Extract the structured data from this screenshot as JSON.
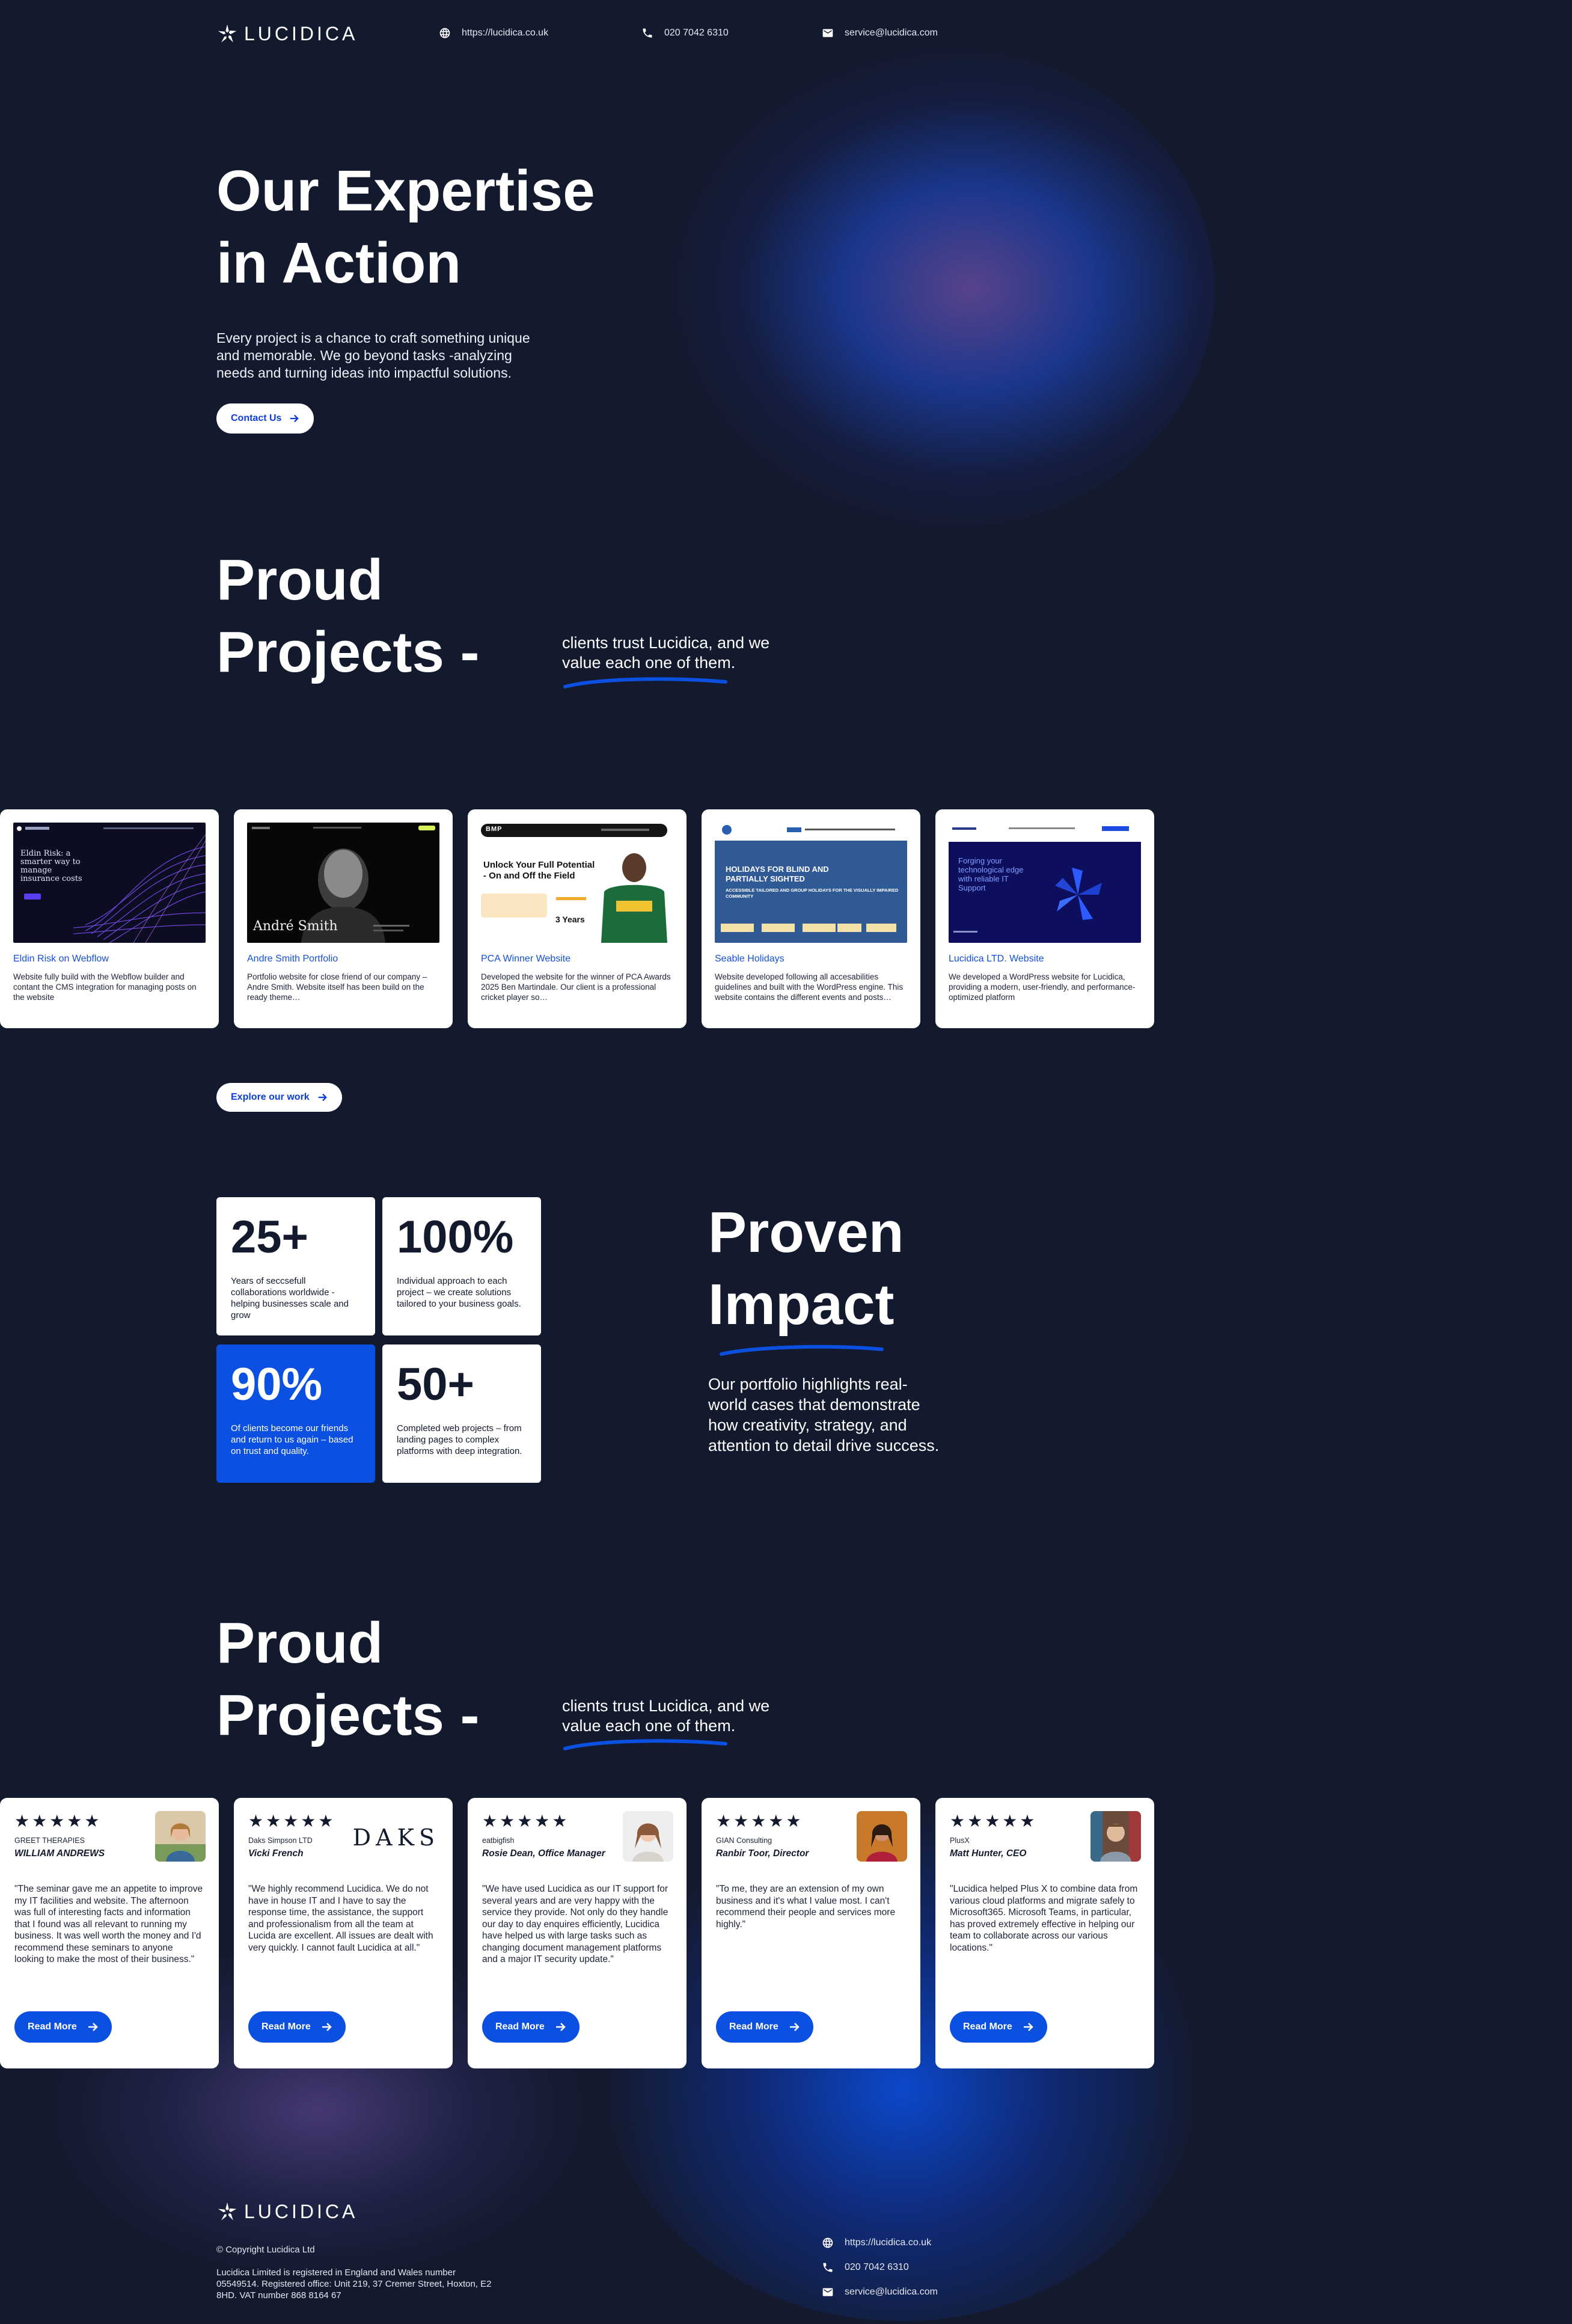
{
  "brand": {
    "name": "LUCIDICA"
  },
  "header": {
    "website": "https://lucidica.co.uk",
    "phone": "020 7042 6310",
    "email": "service@lucidica.com"
  },
  "hero": {
    "title_line1": "Our Expertise",
    "title_line2": "in Action",
    "text": "Every project is a chance to craft something unique and memorable. We go beyond tasks -analyzing needs and turning ideas into impactful solutions.",
    "cta": "Contact Us"
  },
  "projects_section": {
    "title_line1": "Proud",
    "title_line2": "Projects -",
    "trust_text": "clients trust Lucidica, and we value each one of them.",
    "explore": "Explore our work",
    "items": [
      {
        "title": "Eldin Risk on Webflow",
        "desc": "Website fully build with the Webflow builder and contant the CMS integration for managing posts on the website",
        "thumb": {
          "headline": "Eldin Risk: a smarter way to manage insurance costs"
        }
      },
      {
        "title": "Andre Smith Portfolio",
        "desc": "Portfolio website for close friend of our company – Andre Smith. Website itself has been build on the ready theme…",
        "thumb": {
          "headline": "André Smith"
        }
      },
      {
        "title": "PCA Winner Website",
        "desc": "Developed the website for the winner of PCA Awards 2025 Ben Martindale. Our client is a professional cricket player so…",
        "thumb": {
          "headline": "Unlock Your Full Potential - On and Off the Field",
          "badge": "3 Years",
          "logo": "BMP"
        }
      },
      {
        "title": "Seable Holidays",
        "desc": "Website developed following all accesabilities guidelines and built with the WordPress engine. This website contains the different events and posts…",
        "thumb": {
          "headline": "HOLIDAYS FOR BLIND AND PARTIALLY SIGHTED",
          "sub": "ACCESSIBLE TAILORED AND GROUP HOLIDAYS FOR THE VISUALLY IMPAIRED COMMUNITY"
        }
      },
      {
        "title": "Lucidica LTD. Website",
        "desc": "We developed a WordPress website for Lucidica, providing a modern, user-friendly, and performance-optimized platform",
        "thumb": {
          "headline": "Forging your technological edge with reliable IT Support"
        }
      }
    ]
  },
  "stats": [
    {
      "num": "25+",
      "desc": "Years of seccsefull collaborations worldwide - helping businesses scale and grow"
    },
    {
      "num": "100%",
      "desc": "Individual approach to each project – we create solutions tailored to your business goals."
    },
    {
      "num": "90%",
      "desc": "Of clients become our friends and return to us again – based on trust and quality."
    },
    {
      "num": "50+",
      "desc": "Completed web projects – from landing pages to complex platforms with deep integration."
    }
  ],
  "proven": {
    "title_line1": "Proven",
    "title_line2": "Impact",
    "text": "Our portfolio highlights real-world cases that demonstrate how creativity, strategy, and attention to detail drive success."
  },
  "testimonials_section": {
    "title_line1": "Proud",
    "title_line2": "Projects -",
    "trust_text": "clients trust Lucidica, and we value each one of them.",
    "items": [
      {
        "stars": "★★★★★",
        "company": "GREET THERAPIES",
        "person": "WILLIAM ANDREWS",
        "quote": "\"The seminar gave me an appetite to improve my IT facilities and website. The afternoon was full of interesting facts and information that I found was all relevant to running my business. It was well worth the money and I'd recommend these seminars to anyone looking to make the most of their business.\"",
        "button": "Read More"
      },
      {
        "stars": "★★★★★",
        "company": "Daks Simpson LTD",
        "person": "Vicki French",
        "logo": "DAKS",
        "quote": "\"We highly recommend Lucidica. We do not have in house IT and I have to say the response time, the assistance, the support and professionalism from all the team at Lucida are excellent. All issues are dealt with very quickly. I cannot fault Lucidica at all.\"",
        "button": "Read More"
      },
      {
        "stars": "★★★★★",
        "company": "eatbigfish",
        "person": "Rosie Dean, Office Manager",
        "quote": "\"We have used Lucidica as our IT support for several years and are very happy with the service they provide. Not only do they handle our day to day enquires efficiently, Lucidica have helped us with large tasks such as changing document management platforms and a major IT security update.\"",
        "button": "Read More"
      },
      {
        "stars": "★★★★★",
        "company": "GIAN Consulting",
        "person": "Ranbir Toor, Director",
        "quote": "\"To me, they are an extension of my own business and it's what I value most. I can't recommend their people and services more highly.\"",
        "button": "Read More"
      },
      {
        "stars": "★★★★★",
        "company": "PlusX",
        "person": "Matt Hunter, CEO",
        "quote": "\"Lucidica helped Plus X to combine data from various cloud platforms and migrate safely to Microsoft365. Microsoft Teams, in particular, has proved extremely effective in helping our team to collaborate across our various locations.\"",
        "button": "Read More"
      }
    ]
  },
  "footer": {
    "copyright": "© Copyright Lucidica Ltd",
    "registration": "Lucidica Limited is registered in England and Wales number 05549514. Registered office: Unit 219, 37 Cremer Street, Hoxton, E2 8HD. VAT number 868 8164 67",
    "website": "https://lucidica.co.uk",
    "phone": "020 7042 6310",
    "email": "service@lucidica.com"
  },
  "colors": {
    "background": "#141a2e",
    "accent": "#0b50e0",
    "link": "#1450d8",
    "card": "#ffffff"
  }
}
